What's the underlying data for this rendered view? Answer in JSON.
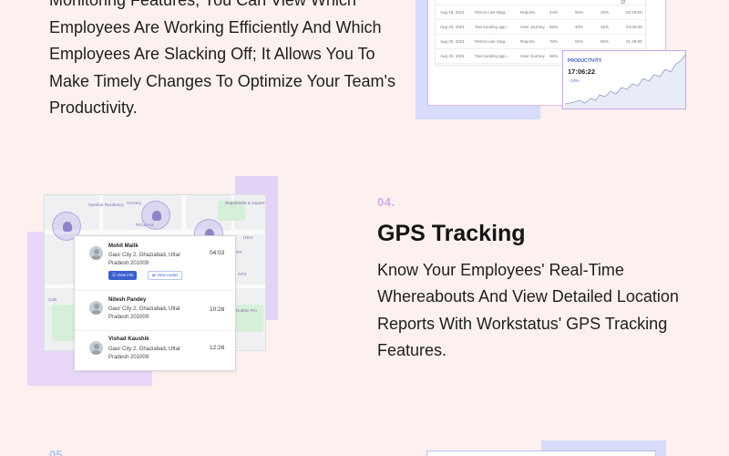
{
  "top_section": {
    "description": "Monitoring Features, You Can View Which Employees Are Working Efficiently And Which Employees Are Slacking Off; It Allows You To Make Timely Changes To Optimize Your Team's Productivity."
  },
  "timesheet_mock": {
    "top_value": "32",
    "rows": [
      {
        "date": "Aug 19, 2021",
        "project": "Petros Live Stag...",
        "task": "Reports",
        "a": "44%",
        "b": "60%",
        "c": "20%",
        "time": "02:18:00"
      },
      {
        "date": "Aug 20, 2021",
        "project": "Taxi booking app...",
        "task": "User Journey",
        "a": "66%",
        "b": "30%",
        "c": "45%",
        "time": "03:00:00"
      },
      {
        "date": "Aug 20, 2021",
        "project": "Petros Live Stag...",
        "task": "Reports",
        "a": "70%",
        "b": "60%",
        "c": "66%",
        "time": "01:49:00"
      },
      {
        "date": "Aug 20, 2021",
        "project": "Taxi booking app...",
        "task": "User Journey",
        "a": "66%",
        "b": "40%",
        "c": "45%",
        "time": "02:00:00"
      }
    ],
    "productivity": {
      "label": "PRODUCTIVITY",
      "time": "17:06:22",
      "change": "↑ 10%",
      "accent": "#3a5ec9"
    }
  },
  "gps": {
    "number": "04.",
    "title": "GPS Tracking",
    "description": "Know Your Employees' Real-Time Whereabouts And View Detailed Location Reports With Workstatus' GPS Tracking Features.",
    "map_labels": {
      "hotel": "Sanskar Residency",
      "grocery": "Grocery",
      "pizza": "Pizza Hut",
      "dept": "Department & Square",
      "tower": "TOWER",
      "cafe": "Cafe",
      "gps": "GPS",
      "ito": "ITEO",
      "rubber": "Rubber Pro"
    },
    "locations": [
      {
        "name": "Mohit Malik",
        "address": "Gaur City 2, Ghaziabad, Uttar Pradesh 201009",
        "time": "04:03",
        "view_info": "View info",
        "view_routes": "View routes"
      },
      {
        "name": "Nitesh Pandey",
        "address": "Gaur City 2, Ghaziabad, Uttar Pradesh 201009",
        "time": "10:28"
      },
      {
        "name": "Vishad Kaushik",
        "address": "Gaur City 2, Ghaziabad, Uttar Pradesh 201009",
        "time": "12:28"
      }
    ]
  },
  "next_section": {
    "number": "05."
  }
}
